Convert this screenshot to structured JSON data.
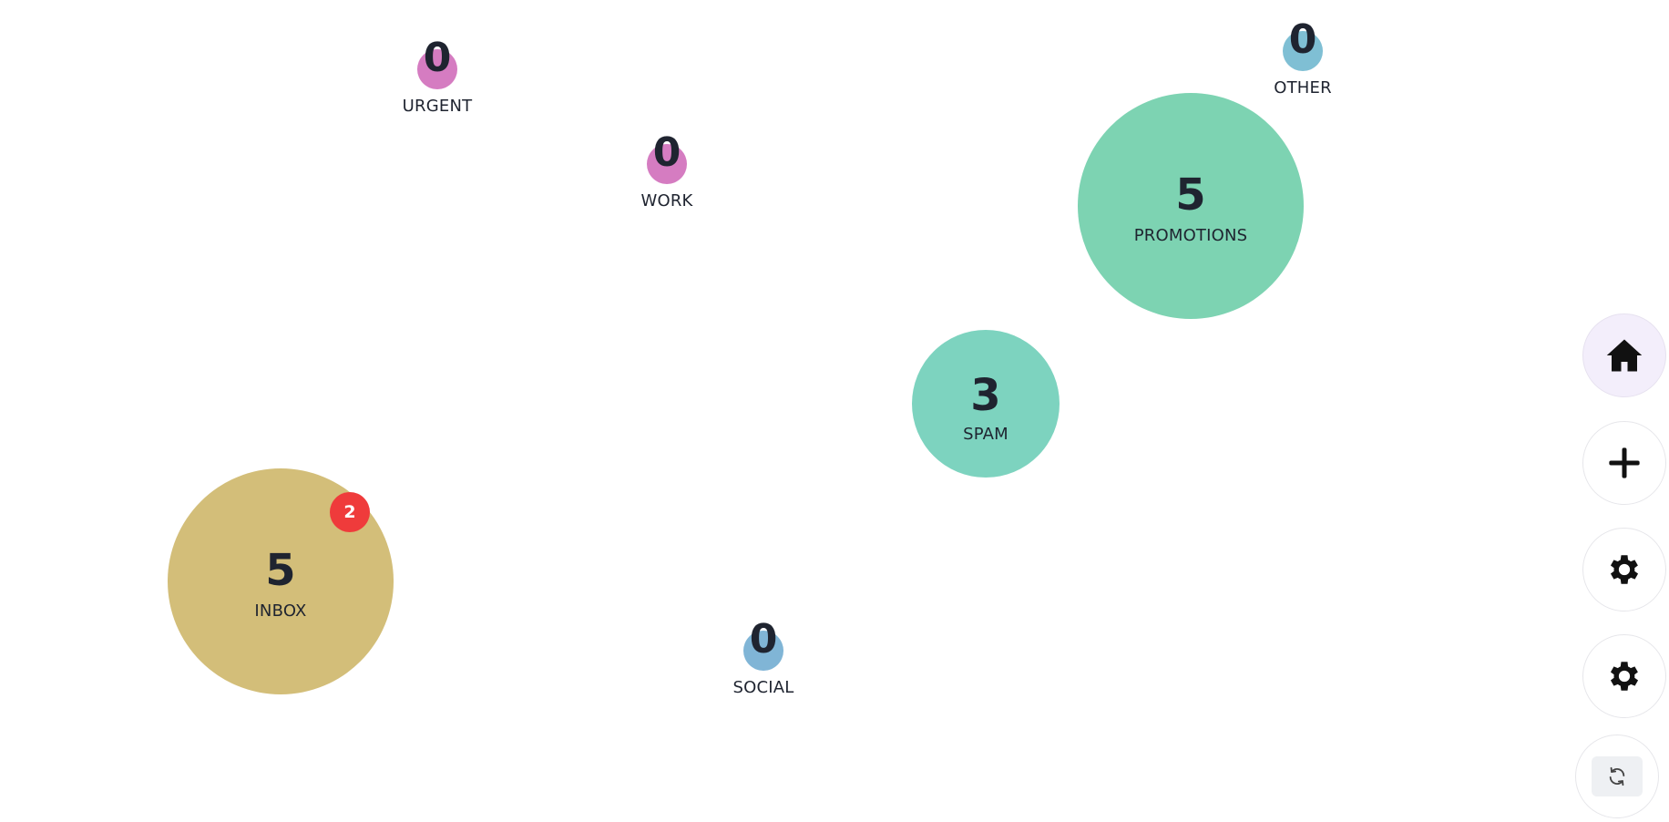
{
  "bubbles": {
    "urgent": {
      "label": "URGENT",
      "count": "0",
      "color": "#d57cc1"
    },
    "work": {
      "label": "WORK",
      "count": "0",
      "color": "#d57cc1"
    },
    "other": {
      "label": "OTHER",
      "count": "0",
      "color": "#7fbfd4"
    },
    "promotions": {
      "label": "PROMOTIONS",
      "count": "5",
      "color": "#7dd3b2"
    },
    "spam": {
      "label": "SPAM",
      "count": "3",
      "color": "#7dd3bf"
    },
    "inbox": {
      "label": "INBOX",
      "count": "5",
      "color": "#d3be79",
      "badge": "2",
      "badge_color": "#ef3b3b"
    },
    "social": {
      "label": "SOCIAL",
      "count": "0",
      "color": "#80b5d6"
    }
  },
  "toolbar": {
    "buttons": [
      {
        "name": "home",
        "icon": "home-icon"
      },
      {
        "name": "add",
        "icon": "plus-icon"
      },
      {
        "name": "settings",
        "icon": "gear-icon"
      },
      {
        "name": "settings-secondary",
        "icon": "gear-icon"
      },
      {
        "name": "refresh",
        "icon": "refresh-icon"
      }
    ]
  }
}
